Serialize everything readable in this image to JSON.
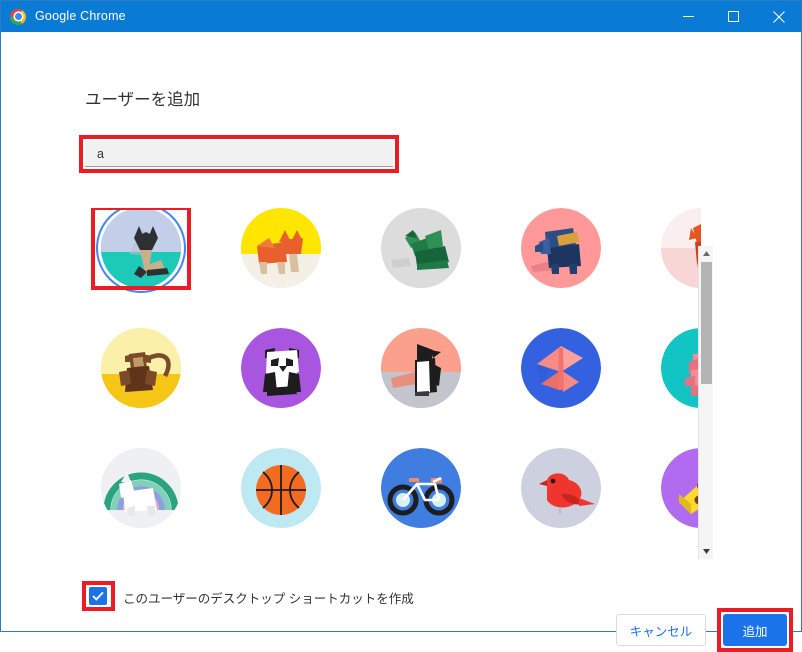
{
  "window": {
    "title": "Google Chrome",
    "logo_icon": "chrome-logo-icon",
    "controls": {
      "minimize_icon": "minimize-icon",
      "maximize_icon": "maximize-icon",
      "close_icon": "close-icon"
    },
    "border_color": "#2b7cc4",
    "titlebar_color": "#0a7bd4"
  },
  "dialog": {
    "heading": "ユーザーを追加",
    "name_input": {
      "value": "a",
      "placeholder": "",
      "highlight_color": "#ec1c24"
    },
    "checkbox": {
      "label": "このユーザーのデスクトップ ショートカットを作成",
      "checked": true,
      "check_icon": "checkmark-icon",
      "highlight_color": "#ec1c24",
      "accent_color": "#1a73e8"
    },
    "buttons": {
      "cancel": "キャンセル",
      "add": "追加",
      "add_highlight_color": "#ec1c24",
      "primary_color": "#1a73e8"
    },
    "scrollbar": {
      "up_arrow_icon": "scroll-up-arrow-icon",
      "down_arrow_icon": "scroll-down-arrow-icon",
      "thumb_position_percent": 0
    }
  },
  "avatars": {
    "selected_index": 0,
    "items": [
      {
        "name": "origami-cat-avatar",
        "bg": "#c3cfe8",
        "bg2": "#1dc9b7",
        "fg": "#c9b08a",
        "fg2": "#2f3033"
      },
      {
        "name": "origami-fox-dog-avatar",
        "bg": "#ffe600",
        "bg2": "#f4f0e6",
        "fg": "#e8602c",
        "fg2": "#d9c0a0"
      },
      {
        "name": "origami-dragon-avatar",
        "bg": "#dcdcdc",
        "bg2": "#cfcfcf",
        "fg": "#1f7a46",
        "fg2": "#13elink"
      },
      {
        "name": "origami-elephant-avatar",
        "bg": "#f99",
        "bg2": "#f78f96",
        "fg": "#2c4d86",
        "fg2": "#1d3661"
      },
      {
        "name": "origami-fox-avatar",
        "bg": "#fbe9ea",
        "bg2": "#f8d6d6",
        "fg": "#e4551f",
        "fg2": "#c9441a"
      },
      {
        "name": "origami-monkey-avatar",
        "bg": "#fbf0a8",
        "bg2": "#f5c518",
        "fg": "#7b4a28",
        "fg2": "#5e351b"
      },
      {
        "name": "origami-panda-avatar",
        "bg": "#a855e0",
        "bg2": "#a855e0",
        "fg": "#ffffff",
        "fg2": "#1d1d1d"
      },
      {
        "name": "origami-penguin-avatar",
        "bg": "#faa08c",
        "bg2": "#c2c6cc",
        "fg": "#ffffff",
        "fg2": "#1d1d1d"
      },
      {
        "name": "origami-butterfly-avatar",
        "bg": "#3461e0",
        "bg2": "#2d55cc",
        "fg": "#f98a86",
        "fg2": "#e86f6a"
      },
      {
        "name": "origami-rabbit-avatar",
        "bg": "#12c4c4",
        "bg2": "#12c4c4",
        "fg": "#f98a9a",
        "fg2": "#e8707f"
      },
      {
        "name": "origami-unicorn-avatar",
        "bg": "#eef0f3",
        "bg2": "#dfe3e8",
        "fg": "#ffffff",
        "fg2": "#2aa37f"
      },
      {
        "name": "basketball-avatar",
        "bg": "#bfe9f2",
        "bg2": "#bfe9f2",
        "fg": "#f26b21",
        "fg2": "#1d1d1d"
      },
      {
        "name": "bicycle-avatar",
        "bg": "#3f7de0",
        "bg2": "#3f7de0",
        "fg": "#ffffff",
        "fg2": "#1d1d1d"
      },
      {
        "name": "red-bird-avatar",
        "bg": "#cdd0de",
        "bg2": "#cdd0de",
        "fg": "#f0352f",
        "fg2": "#c72620"
      },
      {
        "name": "cheese-avatar",
        "bg": "#b06bf0",
        "bg2": "#b06bf0",
        "fg": "#ffd92e",
        "fg2": "#6b4a12"
      }
    ]
  }
}
